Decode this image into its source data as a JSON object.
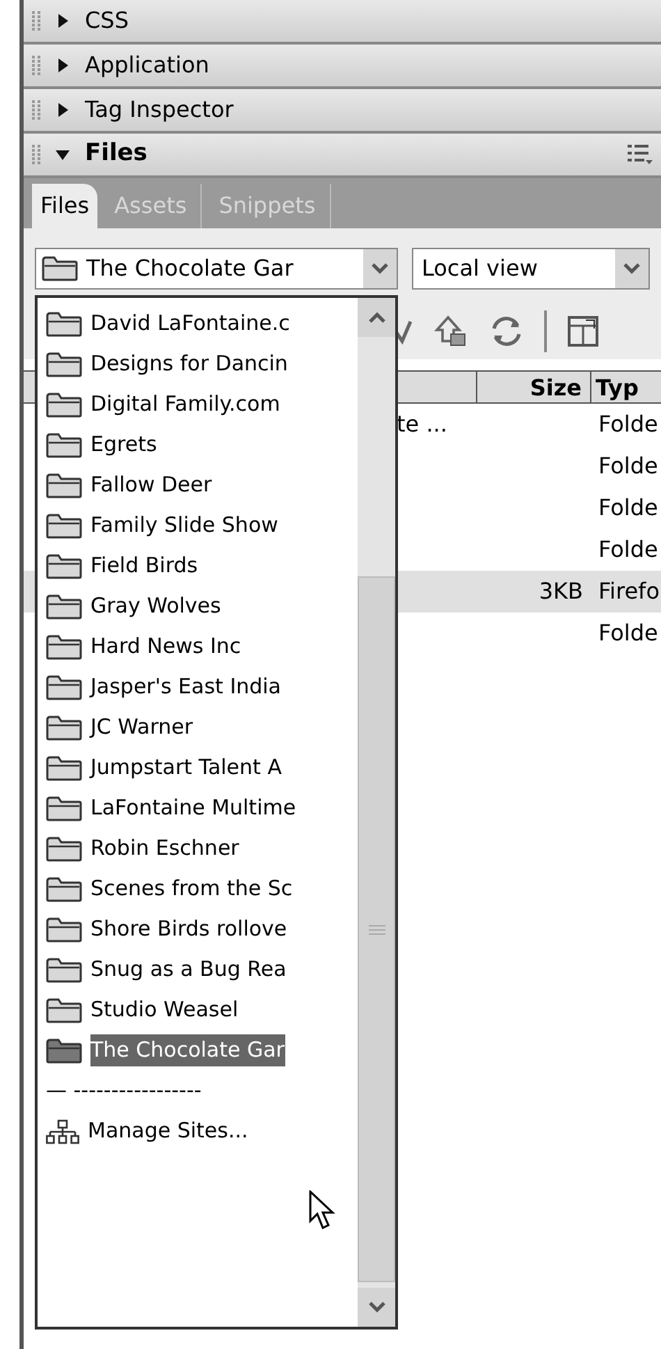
{
  "panels": [
    {
      "title": "CSS",
      "expanded": false
    },
    {
      "title": "Application",
      "expanded": false
    },
    {
      "title": "Tag Inspector",
      "expanded": false
    },
    {
      "title": "Files",
      "expanded": true
    }
  ],
  "tabs": [
    {
      "label": "Files",
      "selected": true
    },
    {
      "label": "Assets",
      "selected": false
    },
    {
      "label": "Snippets",
      "selected": false
    }
  ],
  "site_select": {
    "value": "The Chocolate Gar"
  },
  "view_select": {
    "value": "Local view"
  },
  "table": {
    "columns": [
      "Size",
      "Typ"
    ],
    "rows": [
      {
        "name": "te ...",
        "size": "",
        "type": "Folde",
        "selected": false
      },
      {
        "name": "",
        "size": "",
        "type": "Folde",
        "selected": false
      },
      {
        "name": "",
        "size": "",
        "type": "Folde",
        "selected": false
      },
      {
        "name": "",
        "size": "",
        "type": "Folde",
        "selected": false
      },
      {
        "name": "",
        "size": "3KB",
        "type": "Firefo",
        "selected": true
      },
      {
        "name": "",
        "size": "",
        "type": "Folde",
        "selected": false
      }
    ]
  },
  "site_menu": [
    {
      "kind": "site",
      "label": "David LaFontaine.c",
      "selected": false
    },
    {
      "kind": "site",
      "label": "Designs for Dancin",
      "selected": false
    },
    {
      "kind": "site",
      "label": "Digital Family.com",
      "selected": false
    },
    {
      "kind": "site",
      "label": "Egrets",
      "selected": false
    },
    {
      "kind": "site",
      "label": "Fallow Deer",
      "selected": false
    },
    {
      "kind": "site",
      "label": "Family Slide Show",
      "selected": false
    },
    {
      "kind": "site",
      "label": "Field Birds",
      "selected": false
    },
    {
      "kind": "site",
      "label": "Gray Wolves",
      "selected": false
    },
    {
      "kind": "site",
      "label": "Hard News Inc",
      "selected": false
    },
    {
      "kind": "site",
      "label": "Jasper's East India",
      "selected": false
    },
    {
      "kind": "site",
      "label": "JC Warner",
      "selected": false
    },
    {
      "kind": "site",
      "label": "Jumpstart Talent A",
      "selected": false
    },
    {
      "kind": "site",
      "label": "LaFontaine Multime",
      "selected": false
    },
    {
      "kind": "site",
      "label": "Robin Eschner",
      "selected": false
    },
    {
      "kind": "site",
      "label": "Scenes from the Sc",
      "selected": false
    },
    {
      "kind": "site",
      "label": "Shore Birds rollove",
      "selected": false
    },
    {
      "kind": "site",
      "label": "Snug as a Bug Rea",
      "selected": false
    },
    {
      "kind": "site",
      "label": "Studio Weasel",
      "selected": false
    },
    {
      "kind": "site",
      "label": "The Chocolate Gar",
      "selected": true
    },
    {
      "kind": "separator",
      "label": "—  -----------------"
    },
    {
      "kind": "action",
      "label": "Manage Sites..."
    }
  ]
}
